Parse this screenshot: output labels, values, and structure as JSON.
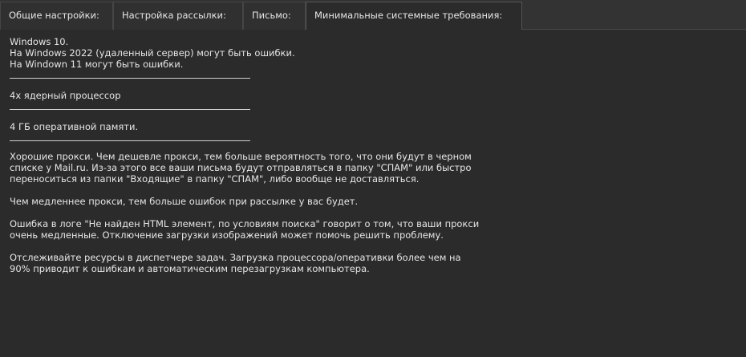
{
  "tabs": [
    {
      "label": "Общие настройки:",
      "active": false
    },
    {
      "label": "Настройка рассылки:",
      "active": false
    },
    {
      "label": "Письмо:",
      "active": false
    },
    {
      "label": "Минимальные системные требования:",
      "active": true
    }
  ],
  "requirements": {
    "os_lines": [
      "Windows 10.",
      "На Windows 2022 (удаленный сервер) могут быть ошибки.",
      "На Windown 11 могут быть ошибки."
    ],
    "cpu": "4х ядерный процессор",
    "ram": "4 ГБ оперативной памяти.",
    "proxy_lines": [
      "Хорошие прокси. Чем дешевле прокси, тем больше вероятность того, что они будут в черном",
      "списке у Mail.ru. Из-за этого все ваши письма будут отправляться в папку \"СПАМ\" или быстро",
      "переноситься из папки \"Входящие\" в папку \"СПАМ\", либо вообще не доставляться."
    ],
    "slow_proxy": "Чем медленнее прокси, тем больше ошибок при рассылке у вас будет.",
    "log_error_lines": [
      "Ошибка в логе \"Не найден HTML элемент, по условиям поиска\" говорит о том, что ваши прокси",
      "очень медленные. Отключение загрузки изображений может помочь решить проблему."
    ],
    "monitor_lines": [
      "Отслеживайте ресурсы в диспетчере задач. Загрузка процессора/оперативки более чем на",
      "90% приводит к ошибкам и автоматическим перезагрузкам компьютера."
    ]
  },
  "colors": {
    "background": "#2b2b2b",
    "tabbar": "#333333",
    "text": "#e6e6e6"
  }
}
